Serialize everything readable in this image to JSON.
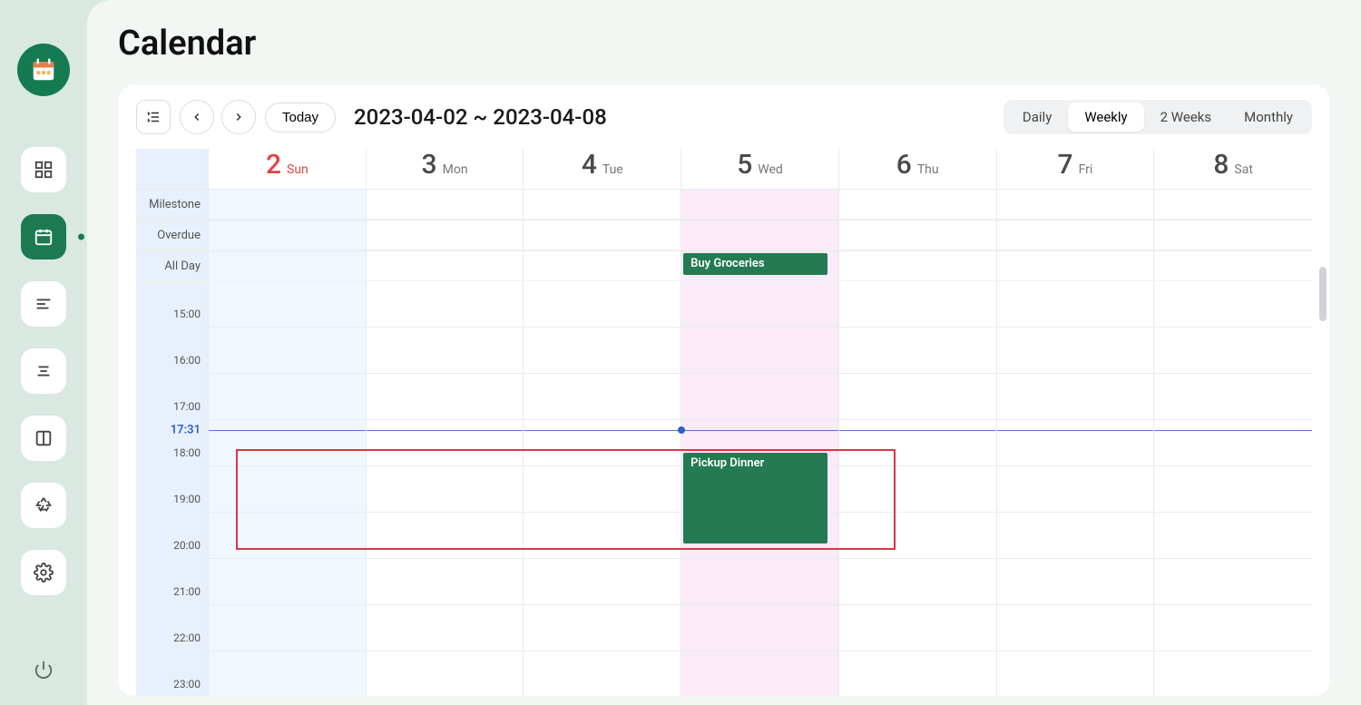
{
  "page_title": "Calendar",
  "toolbar": {
    "today_label": "Today",
    "date_range": "2023-04-02 ~ 2023-04-08"
  },
  "view_tabs": [
    "Daily",
    "Weekly",
    "2 Weeks",
    "Monthly"
  ],
  "active_view": "Weekly",
  "days": [
    {
      "num": "2",
      "dow": "Sun",
      "today": true
    },
    {
      "num": "3",
      "dow": "Mon"
    },
    {
      "num": "4",
      "dow": "Tue"
    },
    {
      "num": "5",
      "dow": "Wed",
      "selected": true
    },
    {
      "num": "6",
      "dow": "Thu"
    },
    {
      "num": "7",
      "dow": "Fri"
    },
    {
      "num": "8",
      "dow": "Sat"
    }
  ],
  "header_rows": [
    "Milestone",
    "Overdue",
    "All Day"
  ],
  "visible_hours": [
    "15:00",
    "16:00",
    "17:00",
    "18:00",
    "19:00",
    "20:00",
    "21:00",
    "22:00",
    "23:00"
  ],
  "current_time": "17:31",
  "allday_events": [
    {
      "title": "Buy Groceries",
      "day_index": 3
    }
  ],
  "timed_events": [
    {
      "title": "Pickup Dinner",
      "day_index": 3,
      "start": "18:00",
      "end": "20:00"
    }
  ],
  "highlight": {
    "start_hour": "18:00",
    "end_hour": "20:00",
    "day_start": 0,
    "day_end": 3
  },
  "sidebar_icons": [
    "dashboard",
    "calendar",
    "notes-left",
    "notes-center",
    "columns",
    "recycle",
    "settings"
  ],
  "active_sidebar": "calendar"
}
